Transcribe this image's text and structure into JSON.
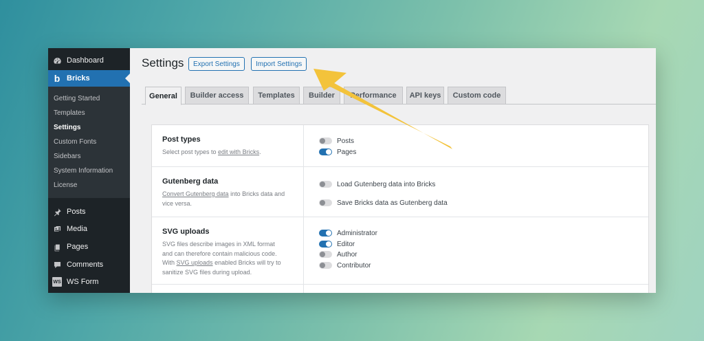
{
  "sidebar": {
    "top_items": [
      {
        "label": "Dashboard",
        "icon": "dashboard-icon"
      },
      {
        "label": "Bricks",
        "icon": "bricks-logo-icon",
        "active": true
      }
    ],
    "submenu": [
      "Getting Started",
      "Templates",
      "Settings",
      "Custom Fonts",
      "Sidebars",
      "System Information",
      "License"
    ],
    "current_sub": "Settings",
    "bottom_items": [
      {
        "label": "Posts",
        "icon": "pin-icon"
      },
      {
        "label": "Media",
        "icon": "media-icon"
      },
      {
        "label": "Pages",
        "icon": "pages-icon"
      },
      {
        "label": "Comments",
        "icon": "comment-icon"
      },
      {
        "label": "WS Form",
        "icon": "ws-form-icon",
        "badge": "WS"
      }
    ]
  },
  "header": {
    "title": "Settings",
    "export_label": "Export Settings",
    "import_label": "Import Settings"
  },
  "tabs": [
    "General",
    "Builder access",
    "Templates",
    "Builder",
    "Performance",
    "API keys",
    "Custom code"
  ],
  "active_tab": "General",
  "sections": [
    {
      "title": "Post types",
      "desc_pre": "Select post types to ",
      "desc_link": "edit with Bricks",
      "desc_post": ".",
      "options": [
        {
          "label": "Posts",
          "on": false
        },
        {
          "label": "Pages",
          "on": true
        }
      ]
    },
    {
      "title": "Gutenberg data",
      "desc_link": "Convert Gutenberg data",
      "desc_post_1": " into Bricks data and",
      "desc_line2": "vice versa.",
      "options": [
        {
          "label": "Load Gutenberg data into Bricks",
          "on": false
        },
        {
          "label": "Save Bricks data as Gutenberg data",
          "on": false
        }
      ]
    },
    {
      "title": "SVG uploads",
      "desc_line1": "SVG files describe images in XML format",
      "desc_line2": "and can therefore contain malicious code.",
      "desc_line3_pre": "With ",
      "desc_line3_link": "SVG uploads",
      "desc_line3_post": " enabled Bricks will try to",
      "desc_line4": "sanitize SVG files during upload.",
      "options": [
        {
          "label": "Administrator",
          "on": true
        },
        {
          "label": "Editor",
          "on": true
        },
        {
          "label": "Author",
          "on": false
        },
        {
          "label": "Contributor",
          "on": false
        }
      ]
    }
  ],
  "colors": {
    "accent": "#2271b1",
    "sidebar": "#1d2327",
    "arrow": "#f3c33b"
  }
}
